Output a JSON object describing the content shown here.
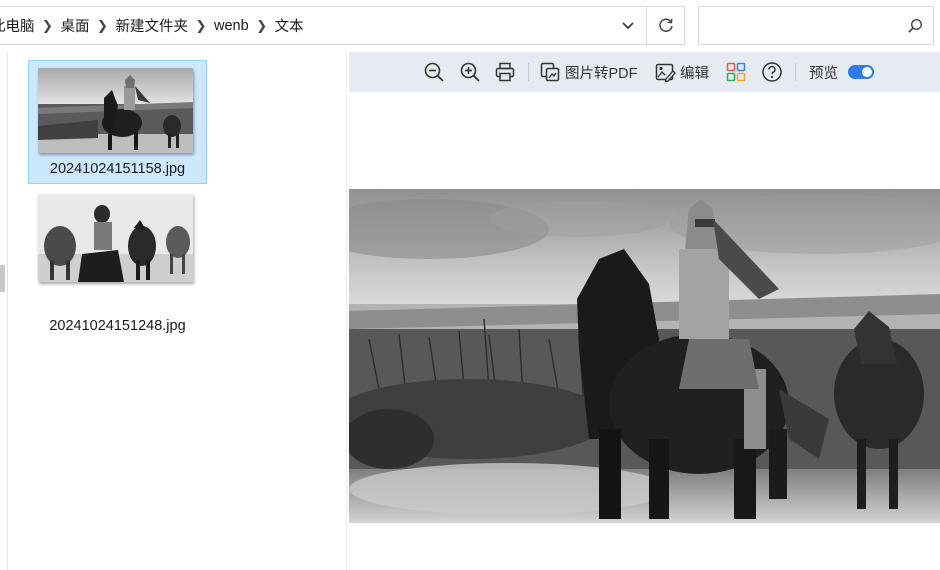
{
  "address_bar": {
    "breadcrumbs": [
      "此电脑",
      "桌面",
      "新建文件夹",
      "wenb",
      "文本"
    ],
    "dropdown_icon": "chevron-down-icon",
    "refresh_icon": "refresh-icon"
  },
  "search": {
    "value": "",
    "placeholder": "",
    "icon": "search-icon"
  },
  "files": [
    {
      "name": "20241024151158.jpg",
      "selected": true
    },
    {
      "name": "20241024151248.jpg",
      "selected": false
    }
  ],
  "preview_toolbar": {
    "zoom_out_icon": "zoom-out-icon",
    "zoom_in_icon": "zoom-in-icon",
    "print_icon": "print-icon",
    "to_pdf_label": "图片转PDF",
    "edit_label": "编辑",
    "apps_icon": "apps-icon",
    "help_icon": "help-icon",
    "preview_label": "预览",
    "preview_toggle_on": true
  },
  "colors": {
    "selection_bg": "#cce8ff",
    "selection_border": "#99d1ff",
    "toolbar_bg": "#e6ebf1",
    "toggle_on": "#2f7be8"
  }
}
